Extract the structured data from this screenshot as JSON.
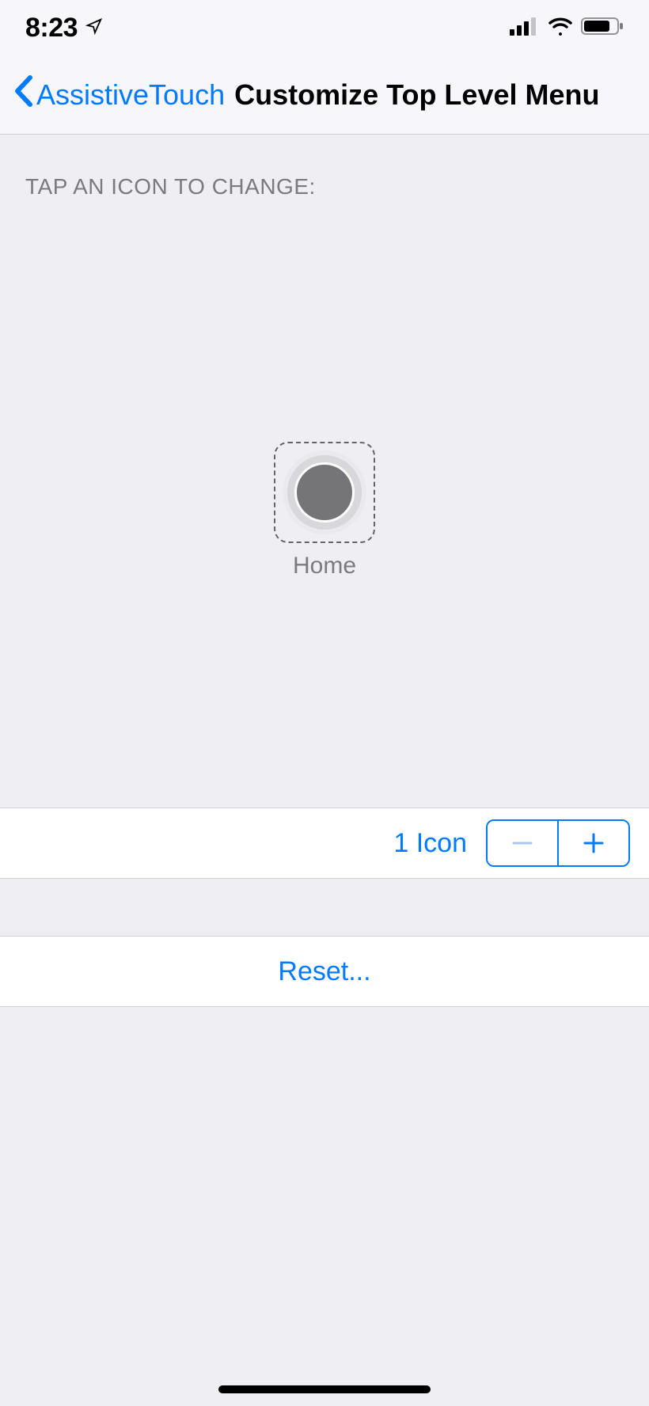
{
  "status": {
    "time": "8:23"
  },
  "nav": {
    "back_label": "AssistiveTouch",
    "title": "Customize Top Level Menu"
  },
  "section_header": "TAP AN ICON TO CHANGE:",
  "icon": {
    "label": "Home"
  },
  "counter": {
    "label": "1 Icon"
  },
  "reset": {
    "label": "Reset..."
  }
}
